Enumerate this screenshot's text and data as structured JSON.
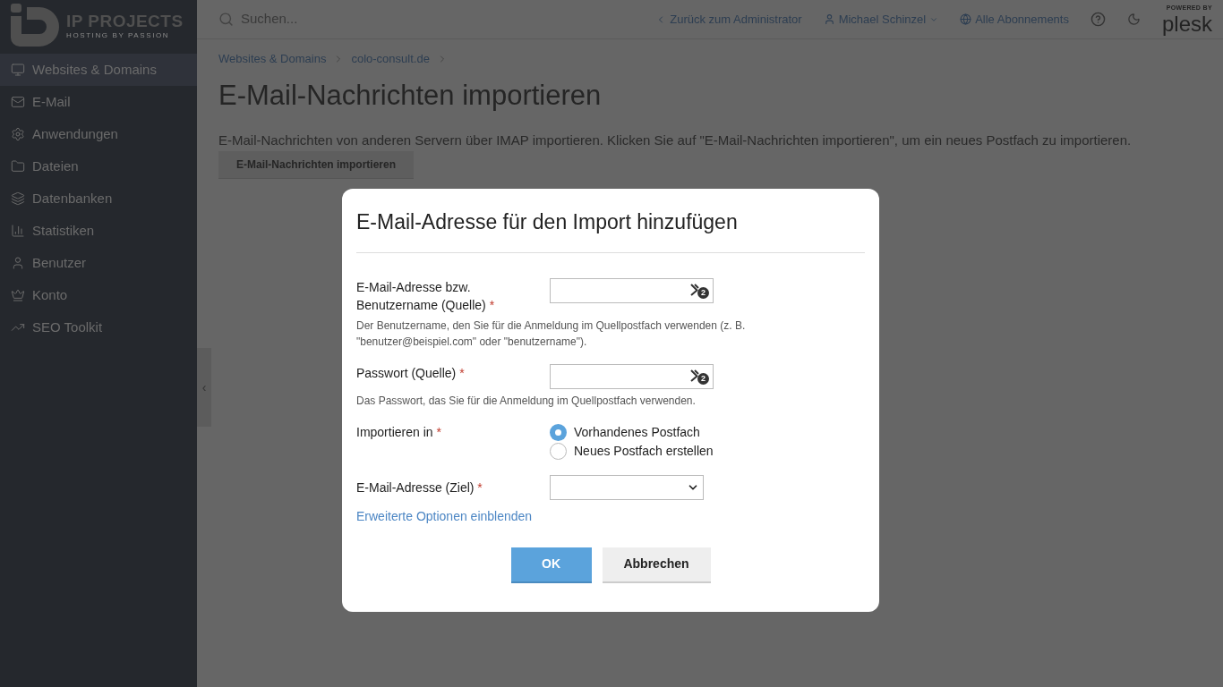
{
  "brand": {
    "name": "IP PROJECTS",
    "tagline": "HOSTING BY PASSION"
  },
  "sidebar": {
    "items": [
      {
        "label": "Websites & Domains",
        "selected": true
      },
      {
        "label": "E-Mail",
        "selected": false
      },
      {
        "label": "Anwendungen",
        "selected": false
      },
      {
        "label": "Dateien",
        "selected": false
      },
      {
        "label": "Datenbanken",
        "selected": false
      },
      {
        "label": "Statistiken",
        "selected": false
      },
      {
        "label": "Benutzer",
        "selected": false
      },
      {
        "label": "Konto",
        "selected": false
      },
      {
        "label": "SEO Toolkit",
        "selected": false
      }
    ],
    "collapse": "‹"
  },
  "topbar": {
    "search": {
      "placeholder": "Suchen..."
    },
    "back": "Zurück zum Administrator",
    "user": "Michael Schinzel",
    "subscriptions": "Alle Abonnements",
    "powered_by": "POWERED BY",
    "product": "plesk"
  },
  "breadcrumbs": [
    "Websites & Domains",
    "colo-consult.de"
  ],
  "page": {
    "title": "E-Mail-Nachrichten importieren",
    "description": "E-Mail-Nachrichten von anderen Servern über IMAP importieren. Klicken Sie auf \"E-Mail-Nachrichten importieren\", um ein neues Postfach zu importieren.",
    "button": "E-Mail-Nachrichten importieren"
  },
  "dialog": {
    "title": "E-Mail-Adresse für den Import hinzufügen",
    "fields": [
      {
        "kind": "text",
        "label": "E-Mail-Adresse bzw. Benutzername (Quelle)",
        "required_mark": "*",
        "badge": "2",
        "hint": "Der Benutzername, den Sie für die Anmeldung im Quellpostfach verwenden (z. B. \"benutzer@beispiel.com\" oder \"benutzername\")."
      },
      {
        "kind": "password",
        "label": "Passwort (Quelle)",
        "required_mark": "*",
        "badge": "2",
        "hint": "Das Passwort, das Sie für die Anmeldung im Quellpostfach verwenden."
      },
      {
        "kind": "radio",
        "label": "Importieren in",
        "required_mark": "*",
        "options": [
          {
            "label": "Vorhandenes Postfach",
            "selected": true
          },
          {
            "label": "Neues Postfach erstellen",
            "selected": false
          }
        ]
      },
      {
        "kind": "select",
        "label": "E-Mail-Adresse (Ziel)",
        "required_mark": "*"
      }
    ],
    "advanced_link": "Erweiterte Optionen einblenden",
    "ok": "OK",
    "cancel": "Abbrechen"
  }
}
